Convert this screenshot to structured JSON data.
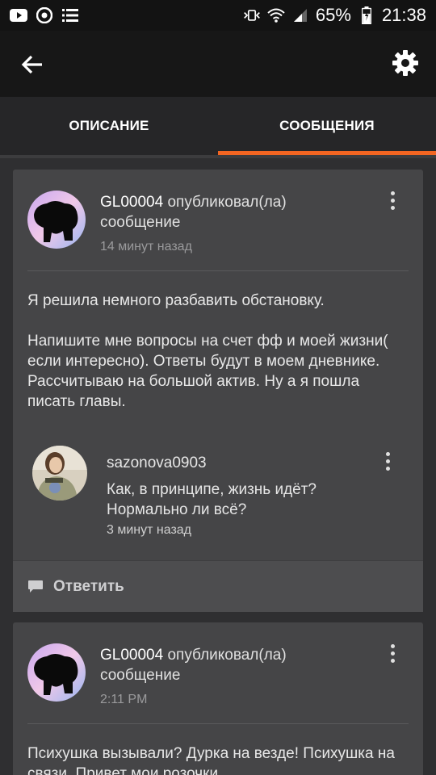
{
  "status_bar": {
    "battery": "65%",
    "time": "21:38",
    "left_icons": [
      "youtube-icon",
      "chrome-icon",
      "list-icon"
    ],
    "right_icons": [
      "vibrate-icon",
      "wifi-icon",
      "signal-icon",
      "battery-icon"
    ]
  },
  "header": {
    "back_icon": "arrow-left-icon",
    "settings_icon": "gear-icon"
  },
  "tabs": [
    {
      "label": "ОПИСАНИЕ",
      "active": false
    },
    {
      "label": "СООБЩЕНИЯ",
      "active": true
    }
  ],
  "accent_color": "#f26522",
  "posts": [
    {
      "author": "GL00004",
      "action": " опубликовал(ла)",
      "action2": "сообщение",
      "time": "14 минут назад",
      "body": [
        " Я решила немного разбавить обстановку.",
        "Напишите мне вопросы на счет фф и моей жизни( если интересно). Ответы будут в моем дневнике.  Рассчитываю на большой актив. Ну а я пошла писать главы."
      ],
      "comment": {
        "user": "sazonova0903",
        "text": "Как, в принципе, жизнь идёт? Нормально ли всё?",
        "time": "3 минут назад"
      },
      "reply_label": "Ответить"
    },
    {
      "author": "GL00004",
      "action": " опубликовал(ла)",
      "action2": "сообщение",
      "time": "2:11 PM",
      "body": [
        "Психушка вызывали? Дурка на везде! Психушка на связи. Привет мои розочки"
      ]
    }
  ]
}
